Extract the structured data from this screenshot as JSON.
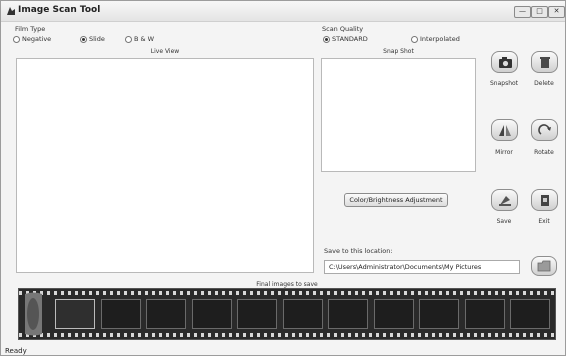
{
  "window": {
    "title": "Image Scan Tool",
    "controls": {
      "minimize": "—",
      "maximize": "□",
      "close": "✕"
    }
  },
  "film_type": {
    "label": "Film Type",
    "options": [
      "Negative",
      "Slide",
      "B & W"
    ],
    "selected": "Slide"
  },
  "scan_quality": {
    "label": "Scan Quality",
    "options": [
      "STANDARD",
      "Interpolated"
    ],
    "selected": "STANDARD"
  },
  "live_view": {
    "caption": "Live View"
  },
  "snap_shot": {
    "caption": "Snap Shot"
  },
  "buttons": {
    "color_adjust": "Color/Brightness Adjustment"
  },
  "tools": {
    "snapshot": "Snapshot",
    "delete": "Delete",
    "mirror": "Mirror",
    "rotate": "Rotate",
    "save": "Save",
    "exit": "Exit"
  },
  "save_location": {
    "label": "Save to this location:",
    "path": "C:\\Users\\Administrator\\Documents\\My Pictures"
  },
  "filmstrip": {
    "caption": "Final images to save",
    "frame_count": 11
  },
  "status": "Ready"
}
